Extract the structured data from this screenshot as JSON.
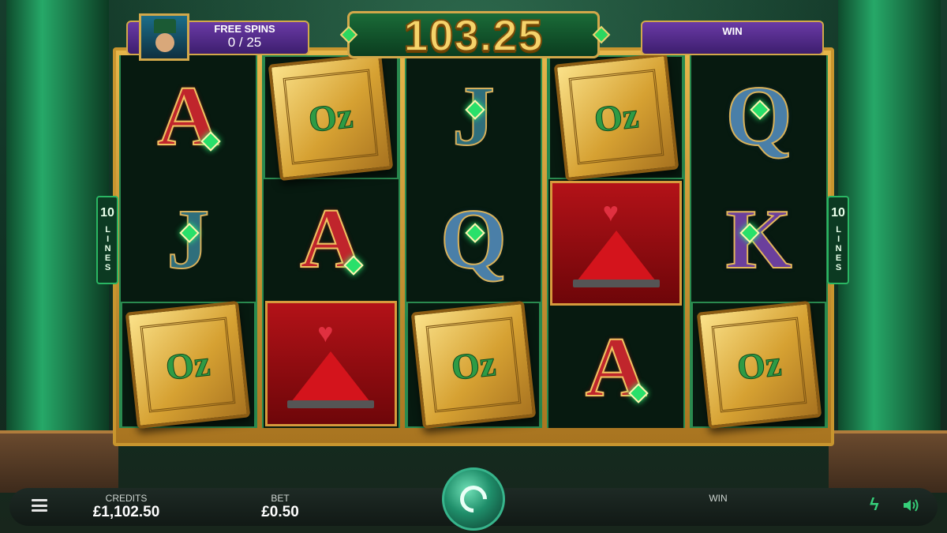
{
  "top": {
    "win_amount": "103.25",
    "free_spins_label": "FREE SPINS",
    "free_spins_count": "0 / 25",
    "win_label": "WIN"
  },
  "side_badges": {
    "lines_number": "10",
    "lines_word": "LINES"
  },
  "reels": [
    [
      "A-red",
      "J",
      "oz-book"
    ],
    [
      "oz-book",
      "A-red",
      "pyramid-wild"
    ],
    [
      "J",
      "Q",
      "oz-book"
    ],
    [
      "oz-book",
      "pyramid-wild",
      "A-red"
    ],
    [
      "Q",
      "K",
      "oz-book"
    ]
  ],
  "symbols": {
    "letter_A": "A",
    "letter_J": "J",
    "letter_Q": "Q",
    "letter_K": "K",
    "book_text": "Oz"
  },
  "bottom": {
    "credits_label": "CREDITS",
    "credits_value": "£1,102.50",
    "bet_label": "BET",
    "bet_value": "£0.50",
    "win_label": "WIN",
    "win_value": ""
  },
  "colors": {
    "accent_green": "#2cd760",
    "gold": "#d2a84a",
    "panel_purple": "#6a3aa6"
  },
  "icons": [
    "menu-icon",
    "spin-icon",
    "bolt-icon",
    "speaker-icon"
  ]
}
